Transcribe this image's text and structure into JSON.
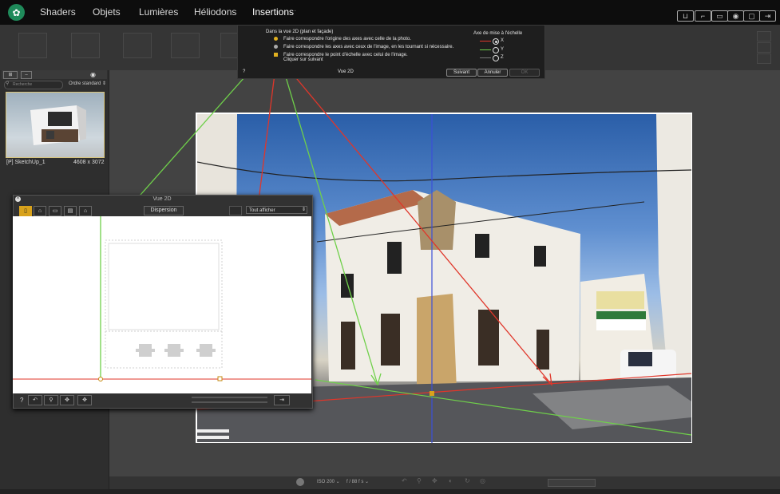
{
  "app": {
    "tabs": [
      "Shaders",
      "Objets",
      "Lumières",
      "Héliodons",
      "Insertions"
    ],
    "active_tab": "Insertions",
    "tab_more": "·",
    "top_icons": [
      "cart-icon",
      "frame-icon",
      "gallery-icon",
      "camera-icon",
      "crop-icon",
      "export-icon"
    ]
  },
  "left_panel": {
    "search_placeholder": "Recherche",
    "sort": "Ordre standard ⇕",
    "thumbnail": {
      "name": "[P] SketchUp_1",
      "size": "4608 x 3072"
    }
  },
  "instructions": {
    "heading": "Dans la vue 2D (plan et façade)",
    "steps": [
      "Faire correspondre l'origine des axes avec celle de la photo.",
      "Faire correspondre les axes avec ceux de l'image, en les tournant si nécessaire.",
      "Faire correspondre le point d'échelle avec celui de l'image.",
      "Cliquer sur suivant"
    ],
    "axis_title": "Axe de mise à l'échelle",
    "axes": [
      "X",
      "Y",
      "Z"
    ],
    "selected_axis": "X",
    "help": "?",
    "view_label": "Vue 2D",
    "buttons": {
      "next": "Suivant",
      "cancel": "Annuler",
      "ok": "OK"
    }
  },
  "dialog": {
    "title": "Vue 2D",
    "dispersion": "Dispersion",
    "display": "Tout afficher",
    "help": "?"
  },
  "bottom": {
    "iso": "ISO 200 ⌄",
    "aperture": "f / 88 f s ⌄"
  },
  "colors": {
    "green_axis": "#6fd04a",
    "red_axis": "#e0362a",
    "blue_axis": "#3b4fd8",
    "active_mode": "#d8a21c"
  }
}
